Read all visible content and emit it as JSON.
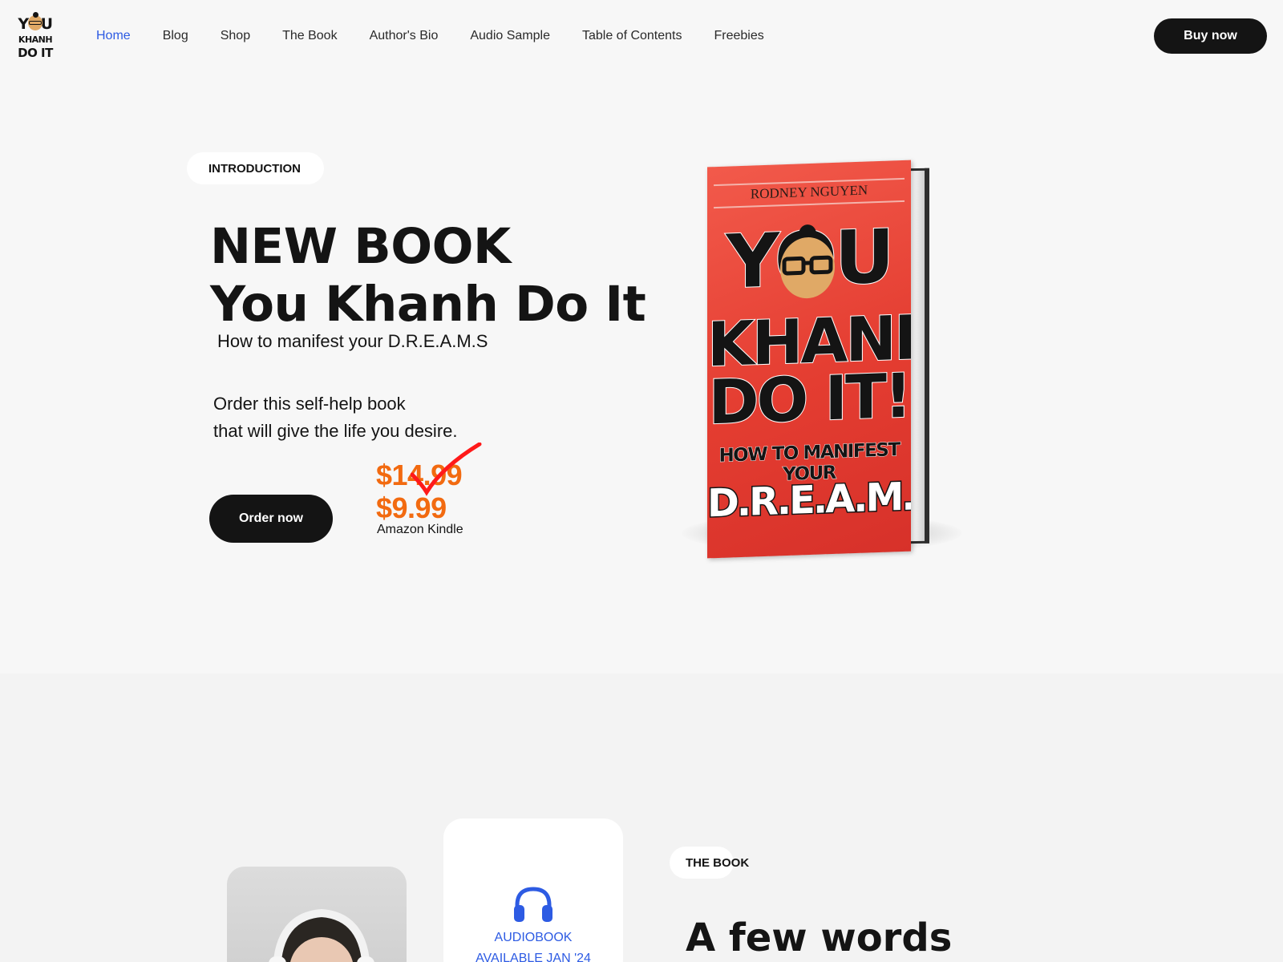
{
  "header": {
    "logo": {
      "line1": "YOU",
      "line2": "KHANH",
      "line3": "DO IT"
    },
    "nav": [
      {
        "label": "Home",
        "active": true
      },
      {
        "label": "Blog",
        "active": false
      },
      {
        "label": "Shop",
        "active": false
      },
      {
        "label": "The Book",
        "active": false
      },
      {
        "label": "Author's Bio",
        "active": false
      },
      {
        "label": "Audio Sample",
        "active": false
      },
      {
        "label": "Table of Contents",
        "active": false
      },
      {
        "label": "Freebies",
        "active": false
      }
    ],
    "buy_label": "Buy now"
  },
  "hero": {
    "pill": "INTRODUCTION",
    "title_line1": "NEW BOOK",
    "title_line2": "You Khanh Do It",
    "subtitle": "How to manifest your D.R.E.A.M.S",
    "desc_line1": "Order this self-help book",
    "desc_line2": "that will give the life you desire.",
    "order_label": "Order now",
    "old_price": "$14.99",
    "new_price": "$9.99",
    "price_note": "Amazon Kindle"
  },
  "book_cover": {
    "author": "RODNEY NGUYEN",
    "line1": "YOU",
    "line2": "KHANH",
    "line3": "DO IT!",
    "line4": "HOW TO MANIFEST YOUR",
    "line5": "D.R.E.A.M.S"
  },
  "section2": {
    "audio_line1": "AUDIOBOOK",
    "audio_line2": "AVAILABLE JAN '24",
    "book_pill": "THE BOOK",
    "heading": "A few words"
  },
  "colors": {
    "accent": "#2d5be3",
    "price": "#f26a10",
    "dark": "#141414",
    "cover_red": "#e43d31"
  },
  "icons": [
    "headphones-icon",
    "strike-mark-icon",
    "logo-face-icon"
  ]
}
